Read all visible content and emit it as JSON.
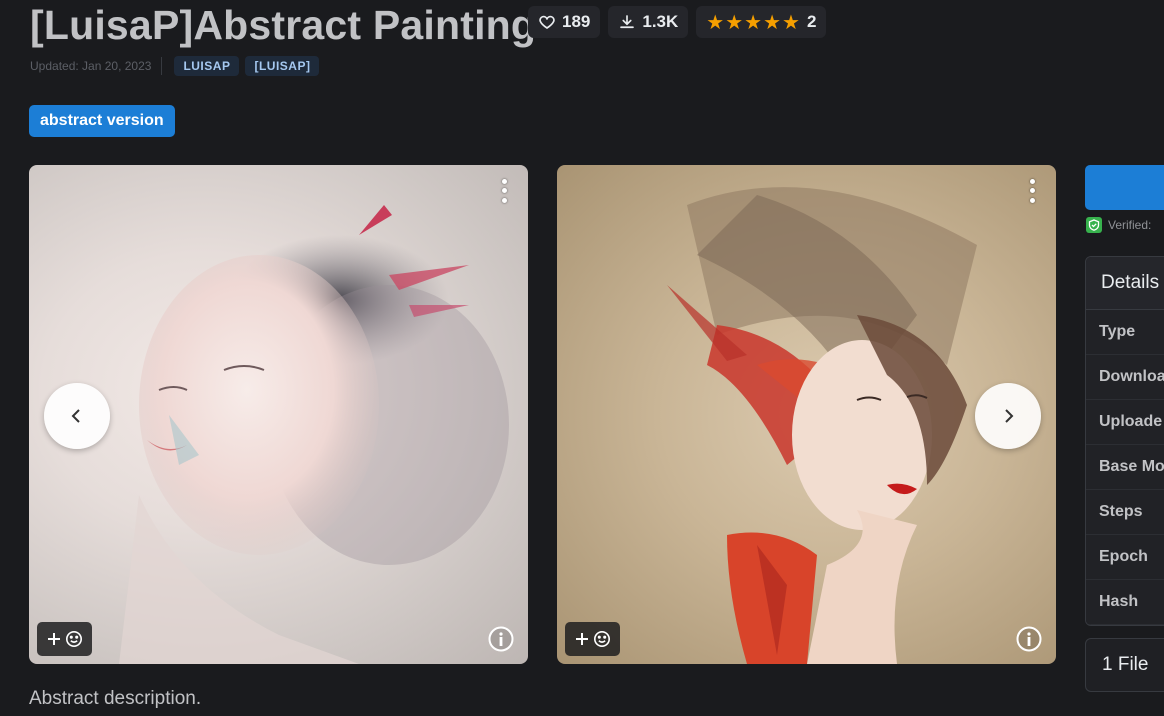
{
  "model": {
    "title": "[LuisaP]Abstract Painting",
    "likes": "189",
    "downloads": "1.3K",
    "rating_stars": "★★★★★",
    "rating_count": "2",
    "updated": "Updated: Jan 20, 2023",
    "tags": [
      "LUISAP",
      "[LUISAP]"
    ],
    "version": "abstract version",
    "description": "Abstract description."
  },
  "gallery": {
    "images": [
      {
        "name": "abstract-woman-portrait-pale"
      },
      {
        "name": "abstract-woman-portrait-red"
      }
    ]
  },
  "sidebar": {
    "verified": "Verified:",
    "details_title": "Details",
    "detail_rows": [
      "Type",
      "Downloa",
      "Uploade",
      "Base Mo",
      "Steps",
      "Epoch",
      "Hash"
    ],
    "files": "1 File"
  },
  "colors": {
    "background": "#1a1b1e",
    "accent": "#1c7ed6",
    "stars": "#f59f00",
    "verified": "#37b24d"
  }
}
